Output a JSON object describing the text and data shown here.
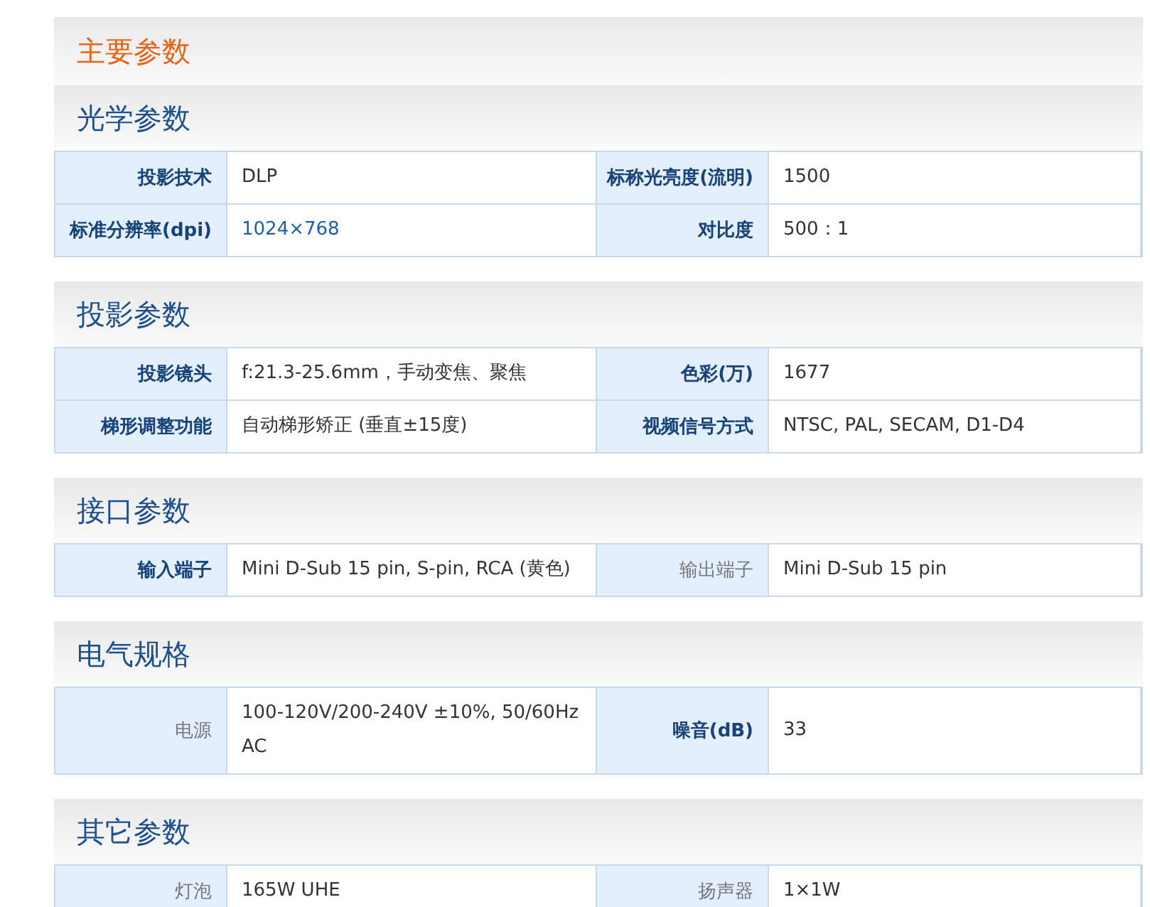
{
  "title": "主要参数",
  "sections": [
    {
      "heading": "光学参数",
      "rows": [
        [
          {
            "label": "投影技术",
            "bold": true,
            "value": "DLP",
            "link": false
          },
          {
            "label": "标称光亮度(流明)",
            "bold": true,
            "value": "1500",
            "link": false
          }
        ],
        [
          {
            "label": "标准分辨率(dpi)",
            "bold": true,
            "value": "1024×768",
            "link": true
          },
          {
            "label": "对比度",
            "bold": true,
            "value": "500：1",
            "link": false
          }
        ]
      ]
    },
    {
      "heading": "投影参数",
      "rows": [
        [
          {
            "label": "投影镜头",
            "bold": true,
            "value": "f:21.3-25.6mm，手动变焦、聚焦",
            "link": false
          },
          {
            "label": "色彩(万)",
            "bold": true,
            "value": "1677",
            "link": false
          }
        ],
        [
          {
            "label": "梯形调整功能",
            "bold": true,
            "value": "自动梯形矫正 (垂直±15度)",
            "link": false
          },
          {
            "label": "视频信号方式",
            "bold": true,
            "value": "NTSC, PAL, SECAM, D1-D4",
            "link": false
          }
        ]
      ]
    },
    {
      "heading": "接口参数",
      "rows": [
        [
          {
            "label": "输入端子",
            "bold": true,
            "value": "Mini D-Sub 15 pin, S-pin, RCA (黄色)",
            "link": false
          },
          {
            "label": "输出端子",
            "bold": false,
            "value": "Mini D-Sub 15 pin",
            "link": false
          }
        ]
      ]
    },
    {
      "heading": "电气规格",
      "rows": [
        [
          {
            "label": "电源",
            "bold": false,
            "value": "100-120V/200-240V ±10%, 50/60Hz AC",
            "link": false
          },
          {
            "label": "噪音(dB)",
            "bold": true,
            "value": "33",
            "link": false
          }
        ]
      ]
    },
    {
      "heading": "其它参数",
      "rows": [
        [
          {
            "label": "灯泡",
            "bold": false,
            "value": "165W UHE",
            "link": false
          },
          {
            "label": "扬声器",
            "bold": false,
            "value": "1×1W",
            "link": false
          }
        ]
      ]
    }
  ]
}
